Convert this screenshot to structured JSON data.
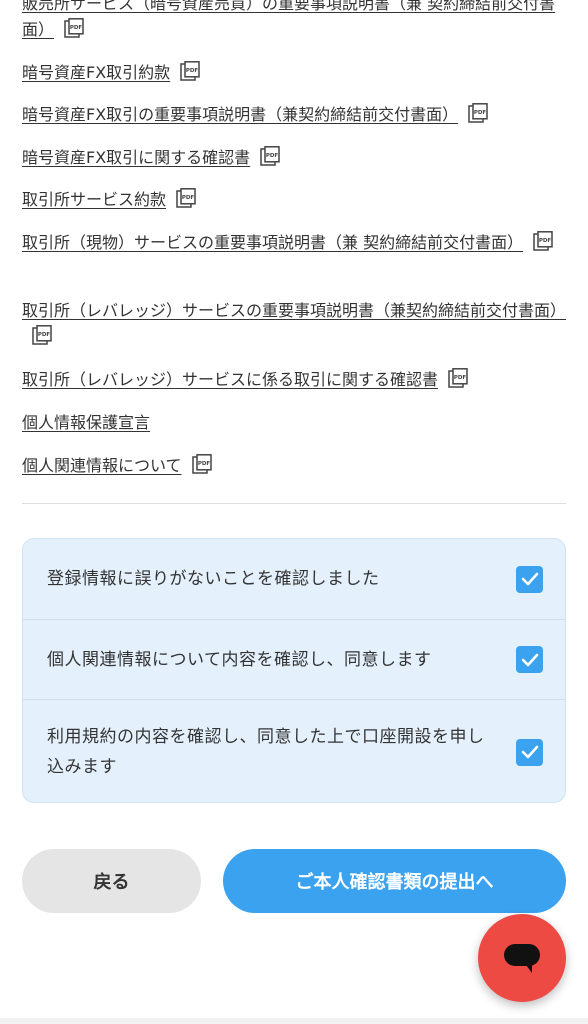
{
  "documents": [
    {
      "label": "販売所サービス（暗号資産売買）の重要事項説明書（兼 契約締結前交付書面）",
      "has_pdf": true
    },
    {
      "label": "暗号資産FX取引約款",
      "has_pdf": true
    },
    {
      "label": "暗号資産FX取引の重要事項説明書（兼契約締結前交付書面）",
      "has_pdf": true
    },
    {
      "label": "暗号資産FX取引に関する確認書",
      "has_pdf": true
    },
    {
      "label": "取引所サービス約款",
      "has_pdf": true
    },
    {
      "label": "取引所（現物）サービスの重要事項説明書（兼 契約締結前交付書面）",
      "has_pdf": true
    },
    {
      "label": "取引所（レバレッジ）サービスの重要事項説明書（兼契約締結前交付書面）",
      "has_pdf": true
    },
    {
      "label": "取引所（レバレッジ）サービスに係る取引に関する確認書",
      "has_pdf": true
    },
    {
      "label": "個人情報保護宣言",
      "has_pdf": false
    },
    {
      "label": "個人関連情報について",
      "has_pdf": true
    }
  ],
  "pdf_icon_text": "PDF",
  "confirmations": [
    {
      "label": "登録情報に誤りがないことを確認しました",
      "checked": true
    },
    {
      "label": "個人関連情報について内容を確認し、同意します",
      "checked": true
    },
    {
      "label": "利用規約の内容を確認し、同意した上で口座開設を申し込みます",
      "checked": true
    }
  ],
  "buttons": {
    "back": "戻る",
    "next": "ご本人確認書類の提出へ"
  },
  "colors": {
    "accent": "#3aa2ef",
    "chat": "#ee4a44",
    "panel": "#e4f1fd"
  },
  "icons": {
    "pdf": "pdf-icon",
    "checkbox": "checkmark-icon",
    "chat": "chat-bubble-icon"
  }
}
